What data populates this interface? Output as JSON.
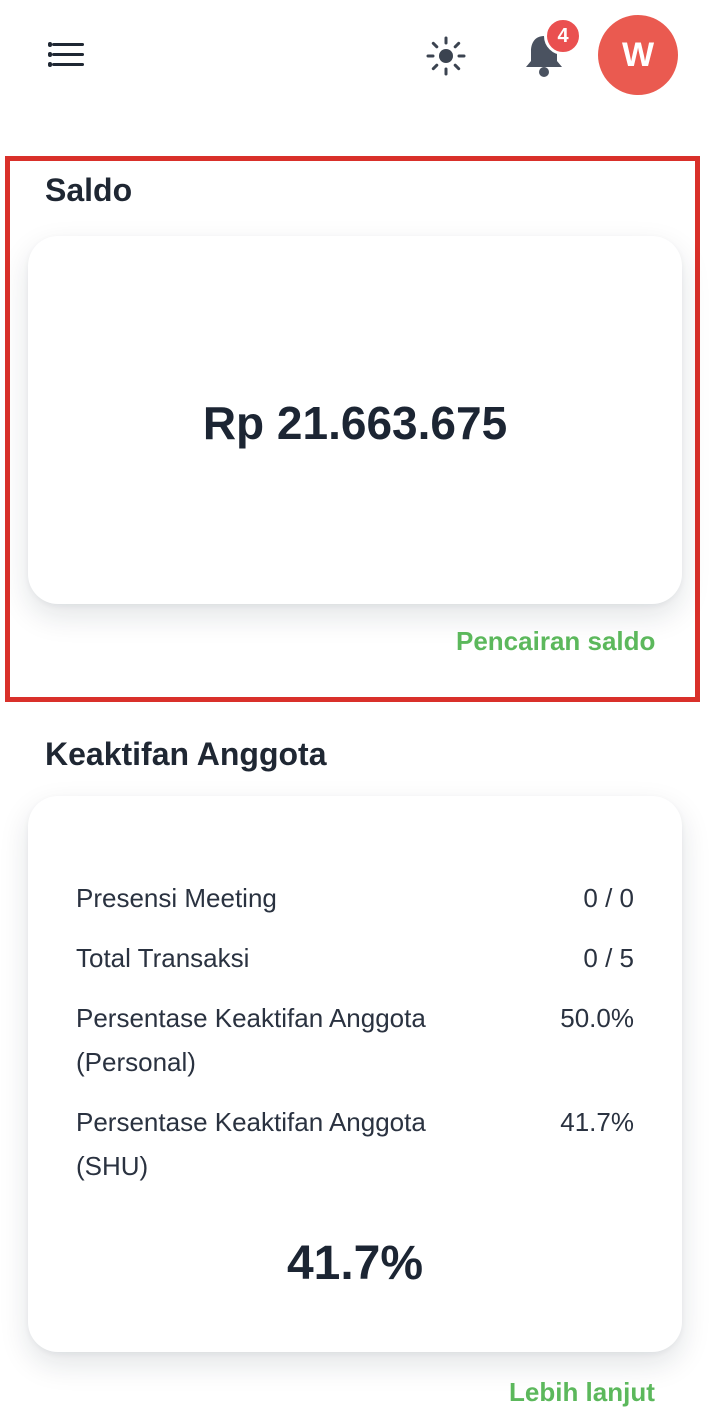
{
  "header": {
    "menu_icon": "hamburger-menu-icon",
    "theme_icon": "sun-icon",
    "notification_icon": "bell-icon",
    "notification_count": "4",
    "avatar_initial": "W",
    "colors": {
      "badge": "#ea5050",
      "avatar": "#ea5a50"
    }
  },
  "saldo": {
    "title": "Saldo",
    "amount": "Rp 21.663.675",
    "link_label": "Pencairan saldo",
    "highlight_color": "#d9302a"
  },
  "activity": {
    "title": "Keaktifan Anggota",
    "rows": [
      {
        "label": "Presensi Meeting",
        "value": "0 / 0"
      },
      {
        "label": "Total Transaksi",
        "value": "0 / 5"
      },
      {
        "label": "Persentase Keaktifan Anggota (Personal)",
        "value": "50.0%"
      },
      {
        "label": "Persentase Keaktifan Anggota (SHU)",
        "value": "41.7%"
      }
    ],
    "summary_percentage": "41.7%",
    "link_label": "Lebih lanjut",
    "link_color": "#5cb85c"
  }
}
